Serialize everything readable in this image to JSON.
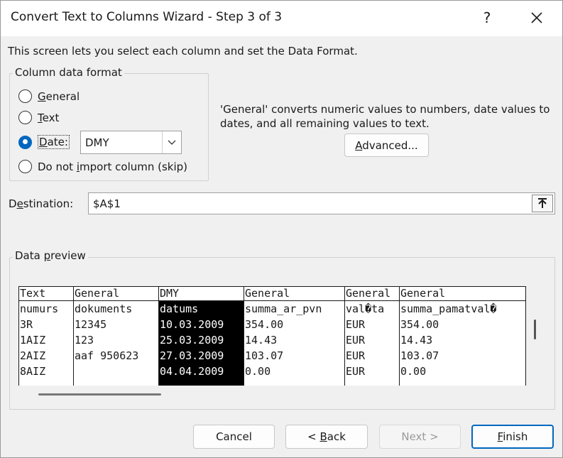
{
  "window": {
    "title": "Convert Text to Columns Wizard - Step 3 of 3",
    "help": "?",
    "close": "✕"
  },
  "intro": "This screen lets you select each column and set the Data Format.",
  "format_group": {
    "label": "Column data format",
    "options": [
      {
        "pre": "",
        "key": "G",
        "post": "eneral",
        "checked": false
      },
      {
        "pre": "",
        "key": "T",
        "post": "ext",
        "checked": false
      },
      {
        "pre": "",
        "key": "D",
        "post": "ate:",
        "checked": true
      },
      {
        "pre": "Do not ",
        "key": "i",
        "post": "mport column (skip)",
        "checked": false
      }
    ],
    "date_select": "DMY"
  },
  "description": "'General' converts numeric values to numbers, date values to dates, and all remaining values to text.",
  "advanced": {
    "key": "A",
    "post": "dvanced..."
  },
  "destination": {
    "key": "e",
    "pre": "D",
    "post": "stination:",
    "value": "$A$1"
  },
  "preview": {
    "label_pre": "Data ",
    "label_key": "p",
    "label_post": "review",
    "columns": [
      {
        "header": "Text",
        "cells": [
          "numurs",
          "3R",
          "1AIZ",
          "2AIZ",
          "8AIZ"
        ],
        "selected": false
      },
      {
        "header": "General",
        "cells": [
          "dokuments",
          "12345",
          "123",
          "aaf 950623",
          ""
        ],
        "selected": false
      },
      {
        "header": "DMY",
        "cells": [
          "datums",
          "10.03.2009",
          "25.03.2009",
          "27.03.2009",
          "04.04.2009"
        ],
        "selected": true
      },
      {
        "header": "General",
        "cells": [
          "summa_ar_pvn",
          "354.00",
          "14.43",
          "103.07",
          "0.00"
        ],
        "selected": false
      },
      {
        "header": "General",
        "cells": [
          "val�ta",
          "EUR",
          "EUR",
          "EUR",
          "EUR"
        ],
        "selected": false
      },
      {
        "header": "General",
        "cells": [
          "summa_pamatval�",
          "354.00",
          "14.43",
          "103.07",
          "0.00"
        ],
        "selected": false
      }
    ]
  },
  "buttons": {
    "cancel": "Cancel",
    "back_pre": "< ",
    "back_key": "B",
    "back_post": "ack",
    "next": "Next >",
    "finish_key": "F",
    "finish_post": "inish"
  },
  "colors": {
    "accent": "#0067c0",
    "selected_column_bg": "#000000"
  }
}
